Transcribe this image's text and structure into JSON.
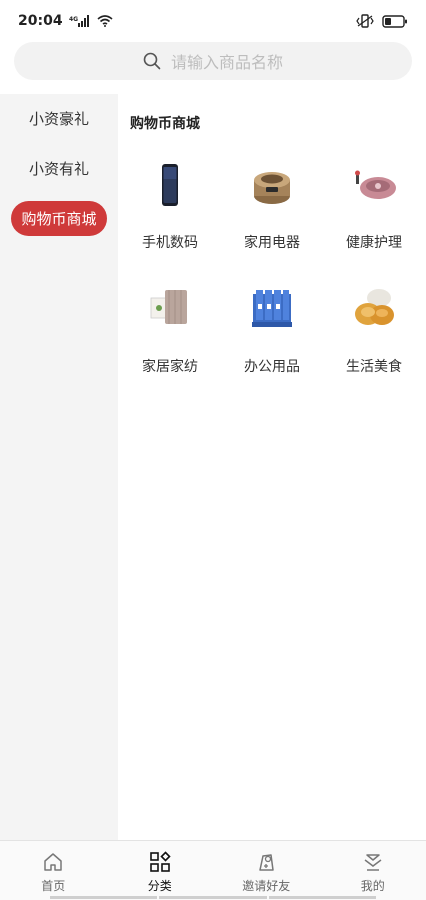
{
  "status": {
    "time": "20:04",
    "network": "4G"
  },
  "search": {
    "placeholder": "请输入商品名称"
  },
  "sidebar": {
    "items": [
      {
        "label": "小资豪礼"
      },
      {
        "label": "小资有礼"
      },
      {
        "label": "购物币商城",
        "active": true
      }
    ]
  },
  "main": {
    "section_title": "购物币商城",
    "categories": [
      {
        "label": "手机数码",
        "icon": "phone-icon"
      },
      {
        "label": "家用电器",
        "icon": "rice-cooker-icon"
      },
      {
        "label": "健康护理",
        "icon": "massager-icon"
      },
      {
        "label": "家居家纺",
        "icon": "towel-icon"
      },
      {
        "label": "办公用品",
        "icon": "file-rack-icon"
      },
      {
        "label": "生活美食",
        "icon": "snack-icon"
      }
    ]
  },
  "tabbar": {
    "tabs": [
      {
        "label": "首页",
        "icon": "home-icon"
      },
      {
        "label": "分类",
        "icon": "category-icon",
        "active": true
      },
      {
        "label": "邀请好友",
        "icon": "invite-icon"
      },
      {
        "label": "我的",
        "icon": "profile-icon"
      }
    ]
  },
  "colors": {
    "accent": "#cf3a3a",
    "sidebar_bg": "#f4f4f4"
  }
}
